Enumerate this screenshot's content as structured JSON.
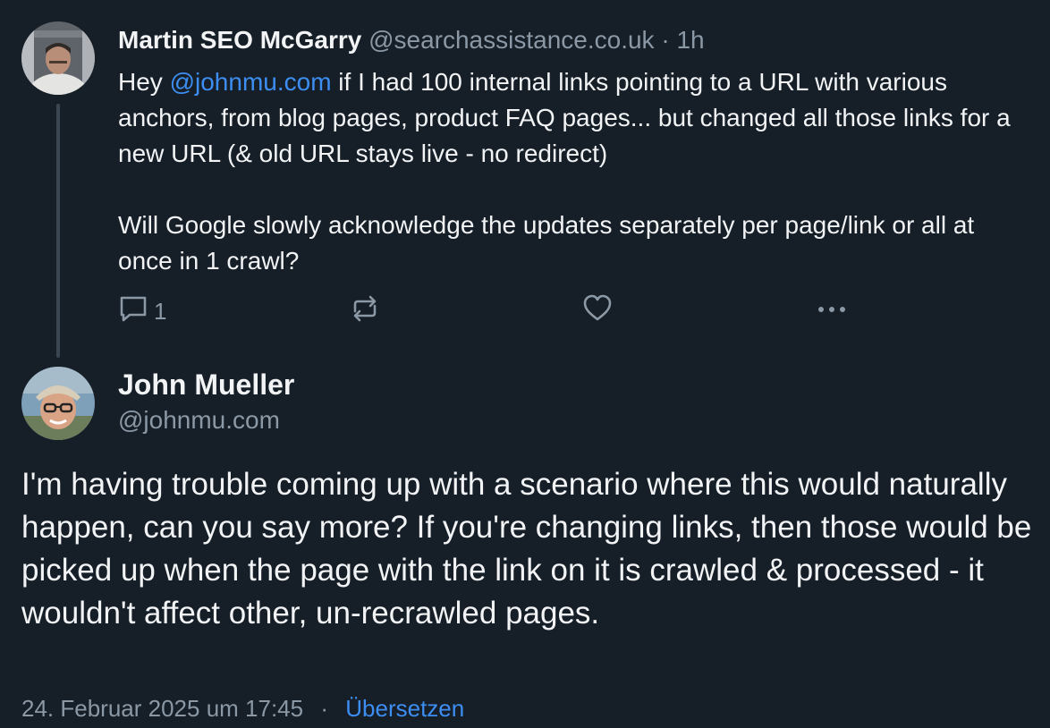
{
  "post1": {
    "author_name": "Martin SEO McGarry",
    "author_handle": "@searchassistance.co.uk",
    "separator": "·",
    "time_ago": "1h",
    "text_prefix": "Hey ",
    "mention": "@johnmu.com",
    "text_rest": " if I had 100 internal links pointing to a URL with various anchors, from blog pages, product FAQ pages... but changed all those links for a new URL (& old URL stays live - no redirect)",
    "text_para2": "Will Google slowly acknowledge the updates separately per page/link or all at once in 1 crawl?",
    "reply_count": "1",
    "icons": [
      "reply-icon",
      "repost-icon",
      "like-icon",
      "more-icon"
    ]
  },
  "post2": {
    "author_name": "John Mueller",
    "author_handle": "@johnmu.com",
    "text": "I'm having trouble coming up with a scenario where this would naturally happen, can you say more? If you're changing links, then those would be picked up when the page with the link on it is crawled & processed - it wouldn't affect other, un-recrawled pages.",
    "timestamp": "24. Februar 2025 um 17:45",
    "separator": "·",
    "translate_label": "Übersetzen"
  },
  "colors": {
    "background": "#161e27",
    "text": "#f1f3f5",
    "muted": "#8b98a5",
    "link": "#3d8ef2",
    "thread_line": "#3b4653"
  }
}
